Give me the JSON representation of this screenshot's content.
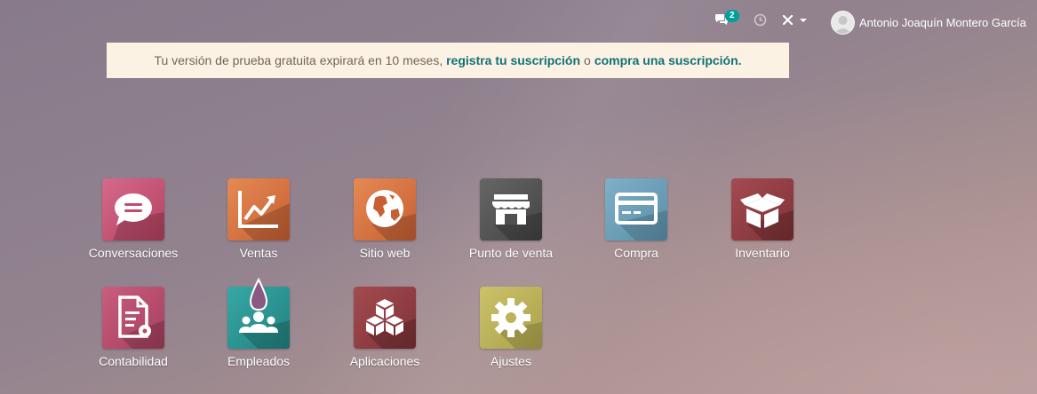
{
  "topbar": {
    "chat_badge": "2",
    "user_name": "Antonio Joaquín Montero García"
  },
  "banner": {
    "text": "Tu versión de prueba gratuita expirará en 10 meses,",
    "link1": "registra tu suscripción",
    "sep": "o",
    "link2": "compra una suscripción."
  },
  "apps": [
    {
      "label": "Conversaciones",
      "color": "#c34a6e",
      "icon": "chat-bubble-icon"
    },
    {
      "label": "Ventas",
      "color": "#d56e3f",
      "icon": "trend-chart-icon"
    },
    {
      "label": "Sitio web",
      "color": "#d8773e",
      "icon": "globe-icon"
    },
    {
      "label": "Punto de venta",
      "color": "#505050",
      "icon": "store-icon"
    },
    {
      "label": "Compra",
      "color": "#6a9cb5",
      "icon": "credit-card-icon"
    },
    {
      "label": "Inventario",
      "color": "#8f3a3f",
      "icon": "box-icon"
    },
    {
      "label": "Contabilidad",
      "color": "#b5496a",
      "icon": "accounting-doc-icon"
    },
    {
      "label": "Empleados",
      "color": "#2b9b99",
      "icon": "employees-icon"
    },
    {
      "label": "Aplicaciones",
      "color": "#8f3a3f",
      "icon": "cubes-icon"
    },
    {
      "label": "Ajustes",
      "color": "#bcb35a",
      "icon": "gear-icon"
    }
  ]
}
